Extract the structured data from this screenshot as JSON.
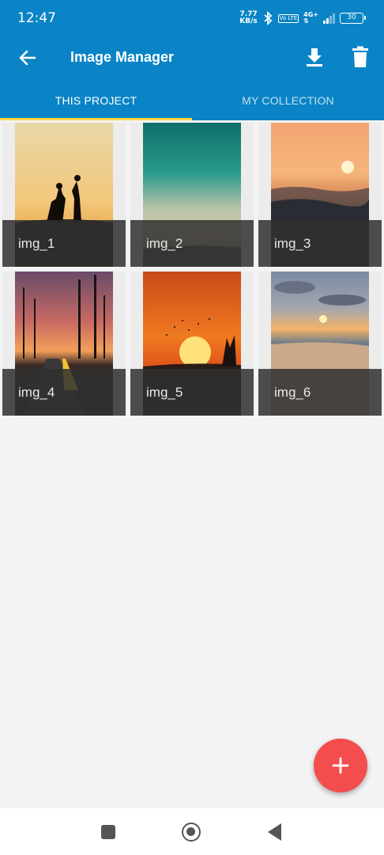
{
  "status_bar": {
    "time": "12:47",
    "net_speed_value": "7.77",
    "net_speed_unit": "KB/s",
    "volte": "Vo LTE",
    "network_type": "4G+",
    "battery": "30"
  },
  "app_bar": {
    "title": "Image Manager",
    "back_icon": "arrow-left-icon",
    "download_icon": "download-icon",
    "delete_icon": "trash-icon"
  },
  "tabs": [
    {
      "label": "THIS PROJECT",
      "active": true
    },
    {
      "label": "MY COLLECTION",
      "active": false
    }
  ],
  "images": [
    {
      "caption": "img_1"
    },
    {
      "caption": "img_2"
    },
    {
      "caption": "img_3"
    },
    {
      "caption": "img_4"
    },
    {
      "caption": "img_5"
    },
    {
      "caption": "img_6"
    }
  ],
  "fab": {
    "icon": "plus-icon"
  },
  "nav": {
    "recent_icon": "square-icon",
    "home_icon": "circle-icon",
    "back_icon": "triangle-back-icon"
  },
  "colors": {
    "primary": "#0a84c6",
    "tab_indicator": "#ffd740",
    "fab": "#f44d4d"
  }
}
